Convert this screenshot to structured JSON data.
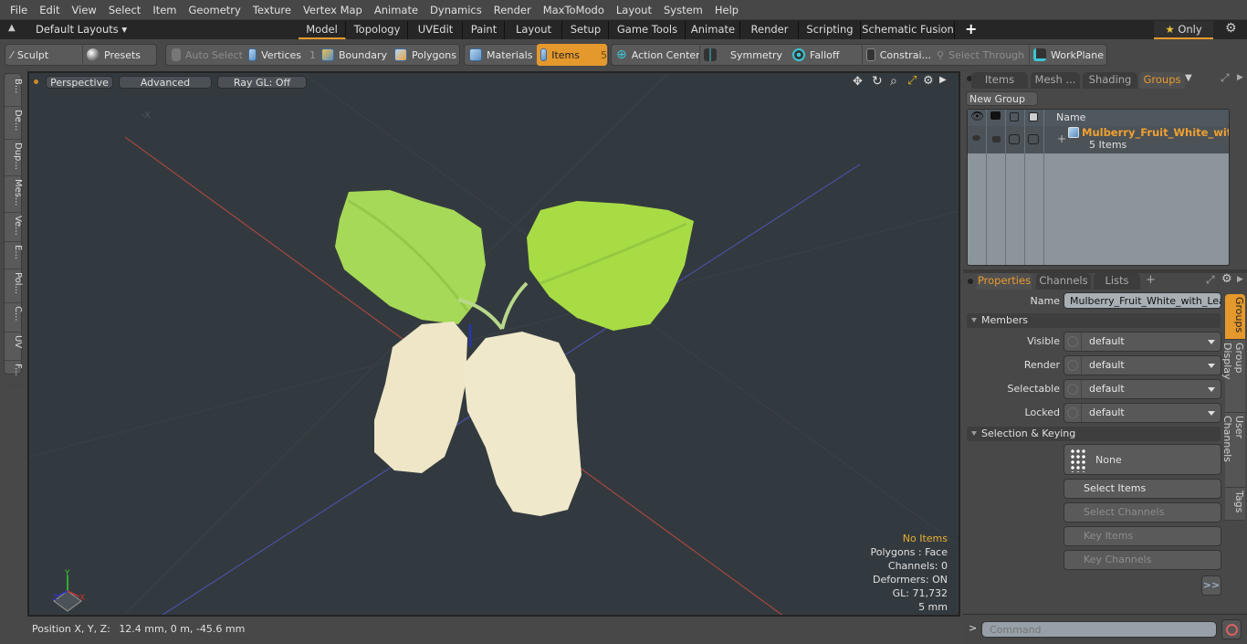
{
  "menu": [
    "File",
    "Edit",
    "View",
    "Select",
    "Item",
    "Geometry",
    "Texture",
    "Vertex Map",
    "Animate",
    "Dynamics",
    "Render",
    "MaxToModo",
    "Layout",
    "System",
    "Help"
  ],
  "layoutbar": {
    "layouts_label": "Default Layouts",
    "tabs": [
      "Model",
      "Topology",
      "UVEdit",
      "Paint",
      "Layout",
      "Setup",
      "Game Tools",
      "Animate",
      "Render",
      "Scripting",
      "Schematic Fusion"
    ],
    "active_tab": "Model",
    "add_tab": "+",
    "only_label": "Only"
  },
  "toolbar": {
    "sculpt": "Sculpt",
    "presets": "Presets",
    "auto_select": "Auto Select",
    "vertices": "Vertices",
    "vertices_count": "1",
    "boundary": "Boundary",
    "polygons": "Polygons",
    "materials": "Materials",
    "items": "Items",
    "items_count": "5",
    "action_center": "Action Center",
    "symmetry": "Symmetry",
    "falloff": "Falloff",
    "constraints": "Constrai...",
    "select_through": "Select Through",
    "workplane": "WorkPlane"
  },
  "left_tabs": [
    "B...",
    "De...",
    "Dup...",
    "Mes...",
    "Ve...",
    "E...",
    "Pol...",
    "C...",
    "UV",
    "F..."
  ],
  "viewport": {
    "perspective": "Perspective",
    "advanced": "Advanced",
    "ray_gl": "Ray GL: Off",
    "stats": {
      "items": "No Items",
      "polygons": "Polygons : Face",
      "channels": "Channels: 0",
      "deformers": "Deformers: ON",
      "gl": "GL: 71,732",
      "scale": "5 mm"
    },
    "axis_labels": {
      "x": "X",
      "y": "Y",
      "z": "Z"
    }
  },
  "statusbar": {
    "position_label": "Position X, Y, Z:",
    "position_value": "12.4 mm, 0 m, -45.6 mm"
  },
  "groups_panel": {
    "tabs": [
      "Items",
      "Mesh ...",
      "Shading",
      "Groups"
    ],
    "active_tab": "Groups",
    "new_group": "New Group",
    "column_name": "Name",
    "group_name": "Mulberry_Fruit_White_wit ...",
    "group_count": "5 Items"
  },
  "properties_panel": {
    "tabs": [
      "Properties",
      "Channels",
      "Lists"
    ],
    "active_tab": "Properties",
    "add_tab": "+",
    "name_label": "Name",
    "name_value": "Mulberry_Fruit_White_with_Leaves",
    "members_section": "Members",
    "fields": [
      {
        "label": "Visible",
        "value": "default"
      },
      {
        "label": "Render",
        "value": "default"
      },
      {
        "label": "Selectable",
        "value": "default"
      },
      {
        "label": "Locked",
        "value": "default"
      }
    ],
    "selection_section": "Selection & Keying",
    "none_label": "None",
    "select_items": "Select Items",
    "select_channels": "Select Channels",
    "key_items": "Key Items",
    "key_channels": "Key Channels",
    "more": ">>",
    "side_tabs": [
      "Groups",
      "Group Display",
      "User Channels",
      "Tags"
    ]
  },
  "command": {
    "prompt": ">",
    "placeholder": "Command"
  },
  "colors": {
    "accent": "#e5982c",
    "viewport_bg": "#333a3f",
    "x_axis": "#c0392b",
    "z_axis": "#4455cc",
    "leaf": "#9ed34a",
    "fruit": "#eee6c8"
  }
}
